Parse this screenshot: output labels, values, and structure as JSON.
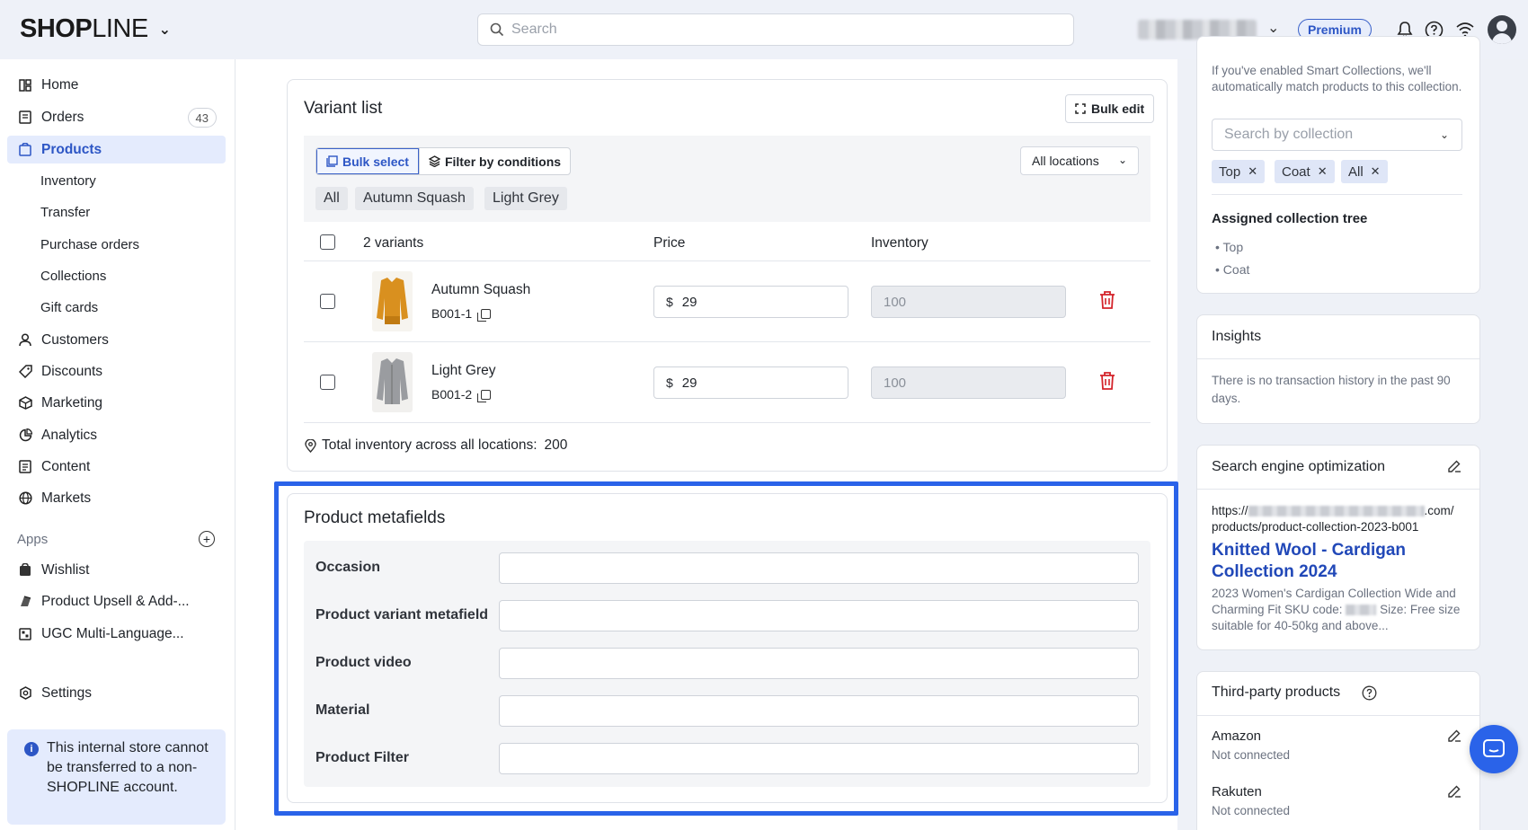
{
  "header": {
    "logo_bold": "SHOP",
    "logo_thin": "LINE",
    "logo_chevron": "⌄",
    "search_placeholder": "Search",
    "plan_badge": "Premium"
  },
  "sidebar": {
    "items": [
      {
        "label": "Home",
        "icon": "dashboard-icon"
      },
      {
        "label": "Orders",
        "icon": "orders-icon",
        "count": "43"
      },
      {
        "label": "Products",
        "icon": "products-icon",
        "active": true
      },
      {
        "label": "Customers",
        "icon": "person-icon"
      },
      {
        "label": "Discounts",
        "icon": "tag-icon"
      },
      {
        "label": "Marketing",
        "icon": "marketing-icon"
      },
      {
        "label": "Analytics",
        "icon": "analytics-icon"
      },
      {
        "label": "Content",
        "icon": "content-icon"
      },
      {
        "label": "Markets",
        "icon": "globe-icon"
      }
    ],
    "sub_items": [
      "Inventory",
      "Transfer",
      "Purchase orders",
      "Collections",
      "Gift cards"
    ],
    "apps_label": "Apps",
    "apps": [
      {
        "label": "Wishlist",
        "icon": "wishlist-app-icon"
      },
      {
        "label": "Product Upsell & Add-...",
        "icon": "upsell-app-icon"
      },
      {
        "label": "UGC Multi-Language...",
        "icon": "ugc-app-icon"
      }
    ],
    "settings_label": "Settings",
    "notice": "This internal store cannot be transferred to a non-SHOPLINE account."
  },
  "variants": {
    "title": "Variant list",
    "bulk_edit": "Bulk edit",
    "bulk_select": "Bulk select",
    "filter_by_conditions": "Filter by conditions",
    "locations": "All locations",
    "chips": [
      "All",
      "Autumn Squash",
      "Light Grey"
    ],
    "headers": {
      "count": "2 variants",
      "price": "Price",
      "inventory": "Inventory"
    },
    "rows": [
      {
        "name": "Autumn Squash",
        "sku": "B001-1",
        "currency": "$",
        "price": "29",
        "inventory": "100",
        "color": "#d9901f"
      },
      {
        "name": "Light Grey",
        "sku": "B001-2",
        "currency": "$",
        "price": "29",
        "inventory": "100",
        "color": "#9a9ca0"
      }
    ],
    "total_label": "Total inventory across all locations:",
    "total_value": "200"
  },
  "metafields": {
    "title": "Product metafields",
    "fields": [
      "Occasion",
      "Product variant metafield",
      "Product video",
      "Material",
      "Product Filter"
    ]
  },
  "collections": {
    "hint": "If you've enabled Smart Collections, we'll automatically match products to this collection.",
    "search_placeholder": "Search by collection",
    "tags": [
      "Top",
      "Coat",
      "All"
    ],
    "tree_title": "Assigned collection tree",
    "tree": [
      "Top",
      "Coat"
    ]
  },
  "insights": {
    "title": "Insights",
    "text": "There is no transaction history in the past 90 days."
  },
  "seo": {
    "title": "Search engine optimization",
    "url_prefix": "https://",
    "url_suffix": ".com/",
    "url_path": "products/product-collection-2023-b001",
    "page_title": "Knitted Wool - Cardigan Collection 2024",
    "desc_start": "2023 Women's Cardigan Collection Wide and Charming Fit SKU code:",
    "desc_end": "Size: Free size suitable for 40-50kg and above..."
  },
  "third_party": {
    "title": "Third-party products",
    "items": [
      {
        "name": "Amazon",
        "status": "Not connected"
      },
      {
        "name": "Rakuten",
        "status": "Not connected"
      }
    ]
  }
}
